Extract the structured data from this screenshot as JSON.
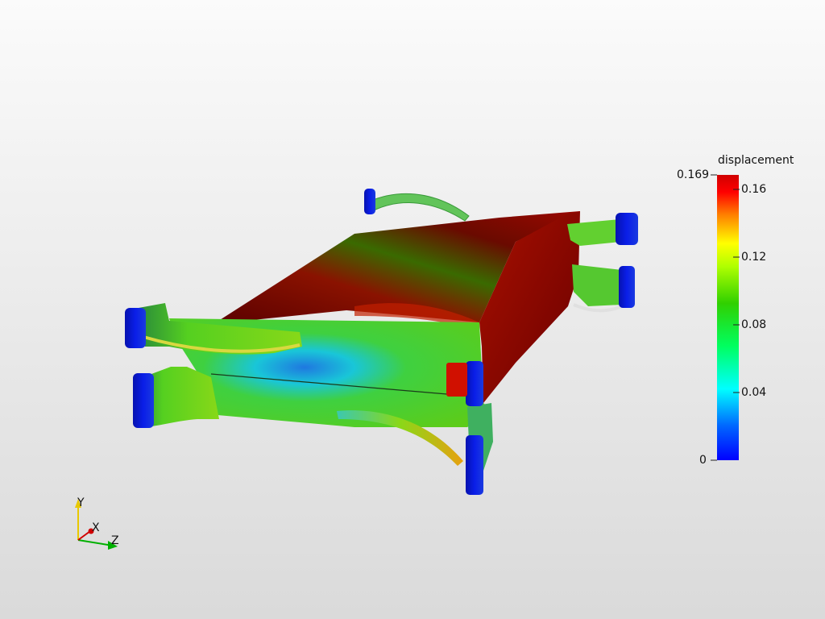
{
  "scalar_bar": {
    "title": "displacement",
    "max_label": "0.169",
    "min_label": "0",
    "tick_labels": [
      "0.16",
      "0.12",
      "0.08",
      "0.04"
    ],
    "colors": [
      "#0000ff",
      "#0080ff",
      "#00ffff",
      "#00ff80",
      "#00d000",
      "#80ff00",
      "#ffff00",
      "#ff8000",
      "#ff0000",
      "#c00000"
    ]
  },
  "orientation_axes": {
    "y_label": "Y",
    "x_label": "X",
    "z_label": "Z",
    "y_color": "#e8c800",
    "x_color": "#d00000",
    "z_color": "#00b000"
  },
  "scene": {
    "field_colors": {
      "high": "#8a0a00",
      "dark": "#4a0000",
      "mid": "#3fc41c",
      "low": "#1a6cd8",
      "cyan": "#19c8c8",
      "clamp": "#0a14d8"
    }
  }
}
